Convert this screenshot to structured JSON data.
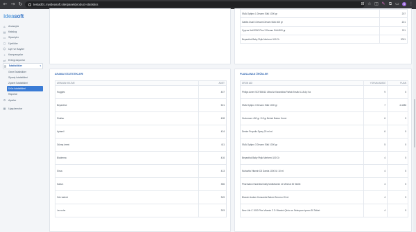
{
  "browser": {
    "url": "testad01.myideasoft.site/panel/product-statistics",
    "profile_initial": "S",
    "icons": [
      "back-icon",
      "forward-icon",
      "reload-icon",
      "lock-icon",
      "translate-icon",
      "bookmark-icon",
      "extension-icon",
      "edit-icon",
      "puzzle-icon",
      "menu-icon"
    ]
  },
  "sidebar": {
    "logo_a": "idea",
    "logo_b": "soft",
    "items": [
      {
        "label": "Anasayfa",
        "icon": "home-icon"
      },
      {
        "label": "Katalog",
        "icon": "catalog-icon"
      },
      {
        "label": "Siparişler",
        "icon": "orders-icon"
      },
      {
        "label": "Üyelikler",
        "icon": "members-icon"
      },
      {
        "label": "Üye ve Bayiler",
        "icon": "users-icon"
      },
      {
        "label": "Kampanyalar",
        "icon": "campaign-icon"
      },
      {
        "label": "Entegrasyonlar",
        "icon": "integration-icon"
      },
      {
        "label": "İstatistikler",
        "icon": "stats-icon"
      }
    ],
    "sub_items": [
      "Genel İstatistikler",
      "Sipariş İstatistikleri",
      "Ziyaret İstatistikleri",
      "Ürün İstatistikleri",
      "Raporlar"
    ],
    "bottom_items": [
      {
        "label": "Ayarlar",
        "icon": "settings-icon"
      },
      {
        "label": "Uygulamalar",
        "icon": "apps-icon"
      }
    ]
  },
  "top_table": {
    "rows": [
      {
        "name": "SMA Optipro 1 Devam Sütü 1000 gr",
        "value": "207"
      },
      {
        "name": "Gabbs Dual 3 Devam Devam Sütü 400 gr",
        "value": "221"
      },
      {
        "name": "Cyprus Hall 9900 Plus 3 Devam Sütü 800 gr",
        "value": "211"
      },
      {
        "name": "Bepanthol Baby Pişik Merhemi 100 Gr",
        "value": "2001"
      }
    ]
  },
  "search_stats": {
    "title": "ARAMA İSTATİSTİKLERİ",
    "columns": [
      "ARANAN KELİME",
      "ADET"
    ],
    "rows": [
      {
        "term": "Huggies",
        "count": "407"
      },
      {
        "term": "Bepanthol",
        "count": "521"
      },
      {
        "term": "Similac",
        "count": "408"
      },
      {
        "term": "Aptamil",
        "count": "424"
      },
      {
        "term": "Güneş kremi",
        "count": "411"
      },
      {
        "term": "Biodermа",
        "count": "416"
      },
      {
        "term": "Sinus",
        "count": "413"
      },
      {
        "term": "Sabun",
        "count": "356"
      },
      {
        "term": "Göz kalemi",
        "count": "349"
      },
      {
        "term": "La roche",
        "count": "303"
      }
    ]
  },
  "rated_products": {
    "title": "PUANLANAN ÜRÜNLER",
    "columns": [
      "ÜRÜN ADI",
      "YORUM ADEDİ",
      "PUAN"
    ],
    "rows": [
      {
        "name": "Philips Avent SCF356/13 Ultra Air Karanlıkta Parlak Emzik 6-18 Ay Kız",
        "comments": "9",
        "score": "5"
      },
      {
        "name": "SMA Optipro 3 Devam Sütü 1000 gr",
        "comments": "7",
        "score": "4.4286"
      },
      {
        "name": "Gudornore 400 gr +18 gr Bebek Bakım Kremi",
        "comments": "6",
        "score": "5"
      },
      {
        "name": "Dexter Propolis Sprey 20 ml ml",
        "comments": "6",
        "score": "5"
      },
      {
        "name": "SMA Optipro 3 Devam Sütü 1000 gr",
        "comments": "5",
        "score": "5"
      },
      {
        "name": "Bepanthol Baby Pişik Merhemi 100 Gr",
        "comments": "4",
        "score": "5"
      },
      {
        "name": "Nutravita Vitamin D3 Damla 1000 IU 10 ml",
        "comments": "4",
        "score": "5"
      },
      {
        "name": "Pharmaton Essential Daily Multivitamin ve Mineral 30 Tablet",
        "comments": "4",
        "score": "5"
      },
      {
        "name": "Bioxcin Aodum Konsantre Bakım Serumu 15 ml",
        "comments": "4",
        "score": "5"
      },
      {
        "name": "New Life C 1000 Plus Vitamin C D Vitamini Çinko ve Selenyum içeren 30 Tablet",
        "comments": "4",
        "score": "5"
      }
    ]
  }
}
